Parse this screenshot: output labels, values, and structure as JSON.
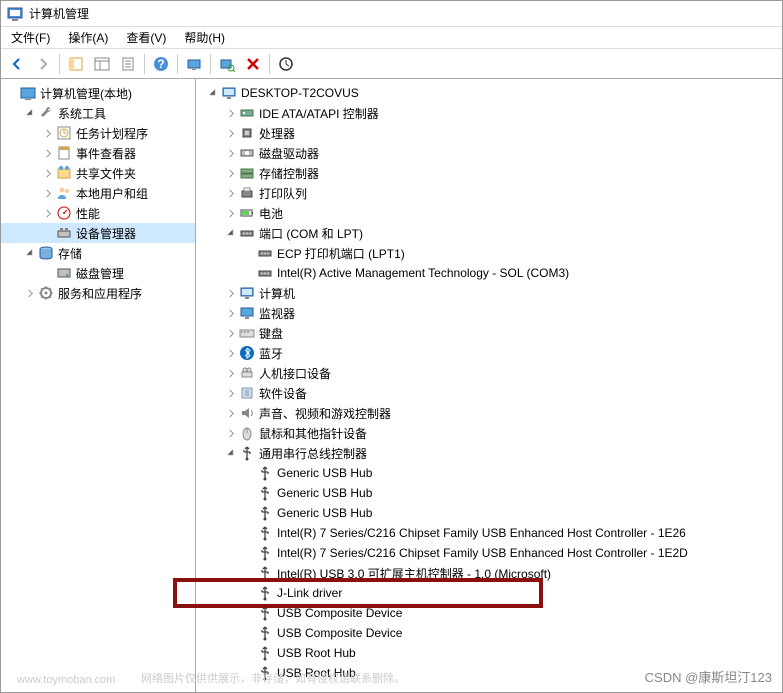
{
  "window_title": "计算机管理",
  "menus": [
    "文件(F)",
    "操作(A)",
    "查看(V)",
    "帮助(H)"
  ],
  "left_tree": [
    {
      "depth": 0,
      "exp": "none",
      "icon": "mgmt",
      "label": "计算机管理(本地)"
    },
    {
      "depth": 1,
      "exp": "open",
      "icon": "wrench",
      "label": "系统工具"
    },
    {
      "depth": 2,
      "exp": "closed",
      "icon": "task",
      "label": "任务计划程序"
    },
    {
      "depth": 2,
      "exp": "closed",
      "icon": "event",
      "label": "事件查看器"
    },
    {
      "depth": 2,
      "exp": "closed",
      "icon": "share",
      "label": "共享文件夹"
    },
    {
      "depth": 2,
      "exp": "closed",
      "icon": "users",
      "label": "本地用户和组"
    },
    {
      "depth": 2,
      "exp": "closed",
      "icon": "perf",
      "label": "性能"
    },
    {
      "depth": 2,
      "exp": "none",
      "icon": "device",
      "label": "设备管理器",
      "selected": true
    },
    {
      "depth": 1,
      "exp": "open",
      "icon": "storage",
      "label": "存储"
    },
    {
      "depth": 2,
      "exp": "none",
      "icon": "disk",
      "label": "磁盘管理"
    },
    {
      "depth": 1,
      "exp": "closed",
      "icon": "services",
      "label": "服务和应用程序"
    }
  ],
  "right_tree": [
    {
      "depth": 0,
      "exp": "open",
      "icon": "pc",
      "label": "DESKTOP-T2COVUS"
    },
    {
      "depth": 1,
      "exp": "closed",
      "icon": "ide",
      "label": "IDE ATA/ATAPI 控制器"
    },
    {
      "depth": 1,
      "exp": "closed",
      "icon": "cpu",
      "label": "处理器"
    },
    {
      "depth": 1,
      "exp": "closed",
      "icon": "diskdrv",
      "label": "磁盘驱动器"
    },
    {
      "depth": 1,
      "exp": "closed",
      "icon": "storctl",
      "label": "存储控制器"
    },
    {
      "depth": 1,
      "exp": "closed",
      "icon": "printq",
      "label": "打印队列"
    },
    {
      "depth": 1,
      "exp": "closed",
      "icon": "battery",
      "label": "电池"
    },
    {
      "depth": 1,
      "exp": "open",
      "icon": "port",
      "label": "端口 (COM 和 LPT)"
    },
    {
      "depth": 2,
      "exp": "none",
      "icon": "port",
      "label": "ECP 打印机端口 (LPT1)"
    },
    {
      "depth": 2,
      "exp": "none",
      "icon": "port",
      "label": "Intel(R) Active Management Technology - SOL (COM3)"
    },
    {
      "depth": 1,
      "exp": "closed",
      "icon": "pc",
      "label": "计算机"
    },
    {
      "depth": 1,
      "exp": "closed",
      "icon": "monitor",
      "label": "监视器"
    },
    {
      "depth": 1,
      "exp": "closed",
      "icon": "keyboard",
      "label": "键盘"
    },
    {
      "depth": 1,
      "exp": "closed",
      "icon": "bt",
      "label": "蓝牙"
    },
    {
      "depth": 1,
      "exp": "closed",
      "icon": "hid",
      "label": "人机接口设备"
    },
    {
      "depth": 1,
      "exp": "closed",
      "icon": "sw",
      "label": "软件设备"
    },
    {
      "depth": 1,
      "exp": "closed",
      "icon": "audio",
      "label": "声音、视频和游戏控制器"
    },
    {
      "depth": 1,
      "exp": "closed",
      "icon": "mouse",
      "label": "鼠标和其他指针设备"
    },
    {
      "depth": 1,
      "exp": "open",
      "icon": "usb",
      "label": "通用串行总线控制器"
    },
    {
      "depth": 2,
      "exp": "none",
      "icon": "usb",
      "label": "Generic USB Hub"
    },
    {
      "depth": 2,
      "exp": "none",
      "icon": "usb",
      "label": "Generic USB Hub"
    },
    {
      "depth": 2,
      "exp": "none",
      "icon": "usb",
      "label": "Generic USB Hub"
    },
    {
      "depth": 2,
      "exp": "none",
      "icon": "usb",
      "label": "Intel(R) 7 Series/C216 Chipset Family USB Enhanced Host Controller - 1E26"
    },
    {
      "depth": 2,
      "exp": "none",
      "icon": "usb",
      "label": "Intel(R) 7 Series/C216 Chipset Family USB Enhanced Host Controller - 1E2D"
    },
    {
      "depth": 2,
      "exp": "none",
      "icon": "usb",
      "label": "Intel(R) USB 3.0 可扩展主机控制器 - 1.0 (Microsoft)"
    },
    {
      "depth": 2,
      "exp": "none",
      "icon": "usb",
      "label": "J-Link driver",
      "highlight": true
    },
    {
      "depth": 2,
      "exp": "none",
      "icon": "usb",
      "label": "USB Composite Device"
    },
    {
      "depth": 2,
      "exp": "none",
      "icon": "usb",
      "label": "USB Composite Device"
    },
    {
      "depth": 2,
      "exp": "none",
      "icon": "usb",
      "label": "USB Root Hub"
    },
    {
      "depth": 2,
      "exp": "none",
      "icon": "usb",
      "label": "USB Root Hub"
    }
  ],
  "toolbar_icons": [
    "back",
    "forward",
    "|",
    "show-hide",
    "console-tree",
    "props",
    "|",
    "help",
    "|",
    "monitor1",
    "|",
    "scan",
    "uninstall",
    "|",
    "legacy"
  ],
  "watermark1": "www.toymoban.com",
  "watermark2": "网络图片仅供供展示，非存储，如有侵权请联系删除。",
  "watermark3": "CSDN @康斯坦汀123"
}
